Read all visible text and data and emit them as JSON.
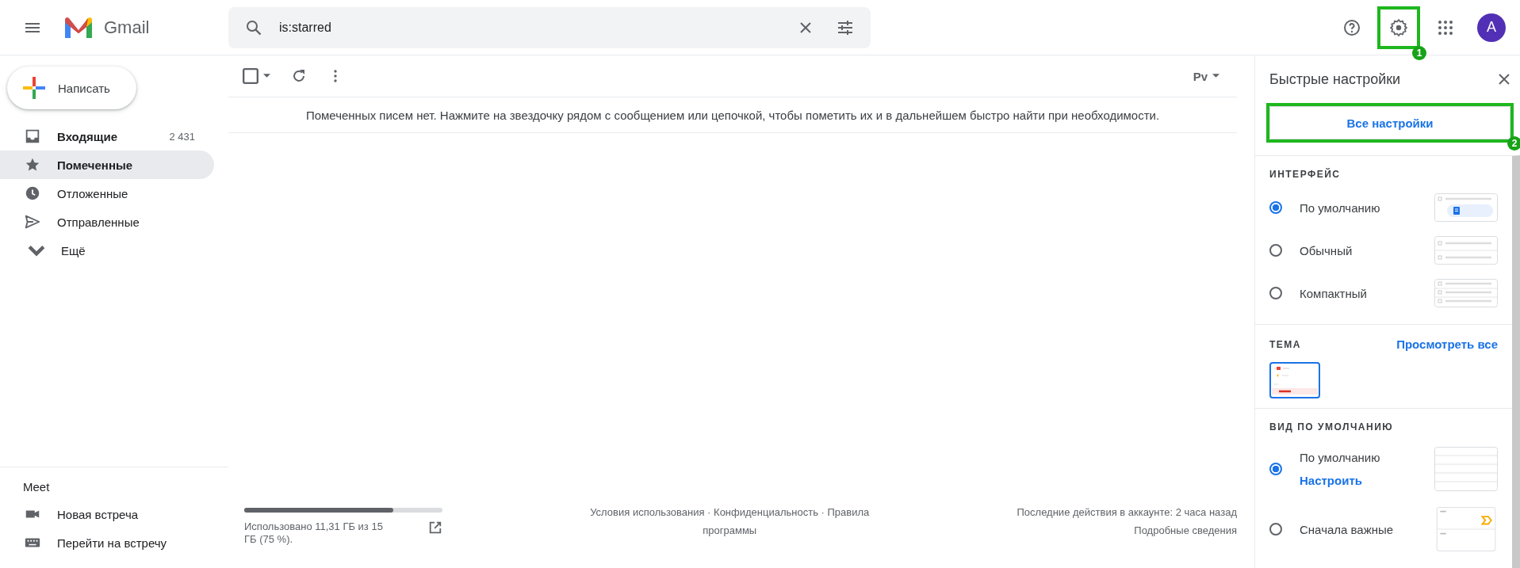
{
  "header": {
    "logo_text": "Gmail",
    "search": {
      "value": "is:starred"
    },
    "avatar": "A"
  },
  "compose": "Написать",
  "nav": [
    {
      "kind": "inbox",
      "label": "Входящие",
      "count": "2 431",
      "bold": true,
      "selected": false
    },
    {
      "kind": "starred",
      "label": "Помеченные",
      "bold": true,
      "selected": true
    },
    {
      "kind": "snoozed",
      "label": "Отложенные",
      "bold": false,
      "selected": false
    },
    {
      "kind": "sent",
      "label": "Отправленные",
      "bold": false,
      "selected": false
    },
    {
      "kind": "more",
      "label": "Ещё",
      "bold": false,
      "selected": false
    }
  ],
  "meet": {
    "title": "Meet",
    "items": [
      {
        "kind": "video",
        "label": "Новая встреча"
      },
      {
        "kind": "keyboard",
        "label": "Перейти на встречу"
      }
    ]
  },
  "toolbar": {
    "select_all": {
      "checked": false
    },
    "input_tool": "Рv"
  },
  "empty_message": "Помеченных писем нет. Нажмите на звездочку рядом с сообщением или цепочкой, чтобы пометить их и в дальнейшем быстро найти при необходимости.",
  "footer": {
    "storage": {
      "level": 0.75,
      "text": "Использовано 11,31 ГБ из 15 ГБ (75 %)."
    },
    "links": "Условия использования · Конфиденциальность · Правила программы",
    "activity": "Последние действия в аккаунте: 2 часа назад",
    "details": "Подробные сведения"
  },
  "quick_settings": {
    "title": "Быстрые настройки",
    "all_settings": "Все настройки",
    "density": {
      "heading": "ИНТЕРФЕЙС",
      "options": [
        {
          "kind": "default",
          "label": "По умолчанию",
          "selected": true
        },
        {
          "kind": "comfortable",
          "label": "Обычный",
          "selected": false
        },
        {
          "kind": "compact",
          "label": "Компактный",
          "selected": false
        }
      ]
    },
    "theme": {
      "heading": "ТЕМА",
      "link": "Просмотреть все"
    },
    "inbox_type": {
      "heading": "ВИД ПО УМОЛЧАНИЮ",
      "options": [
        {
          "kind": "default",
          "label": "По умолчанию",
          "link": "Настроить",
          "selected": true
        },
        {
          "kind": "important",
          "label": "Сначала важные",
          "selected": false
        }
      ]
    }
  },
  "annotations": [
    {
      "label": "1"
    },
    {
      "label": "2"
    }
  ]
}
